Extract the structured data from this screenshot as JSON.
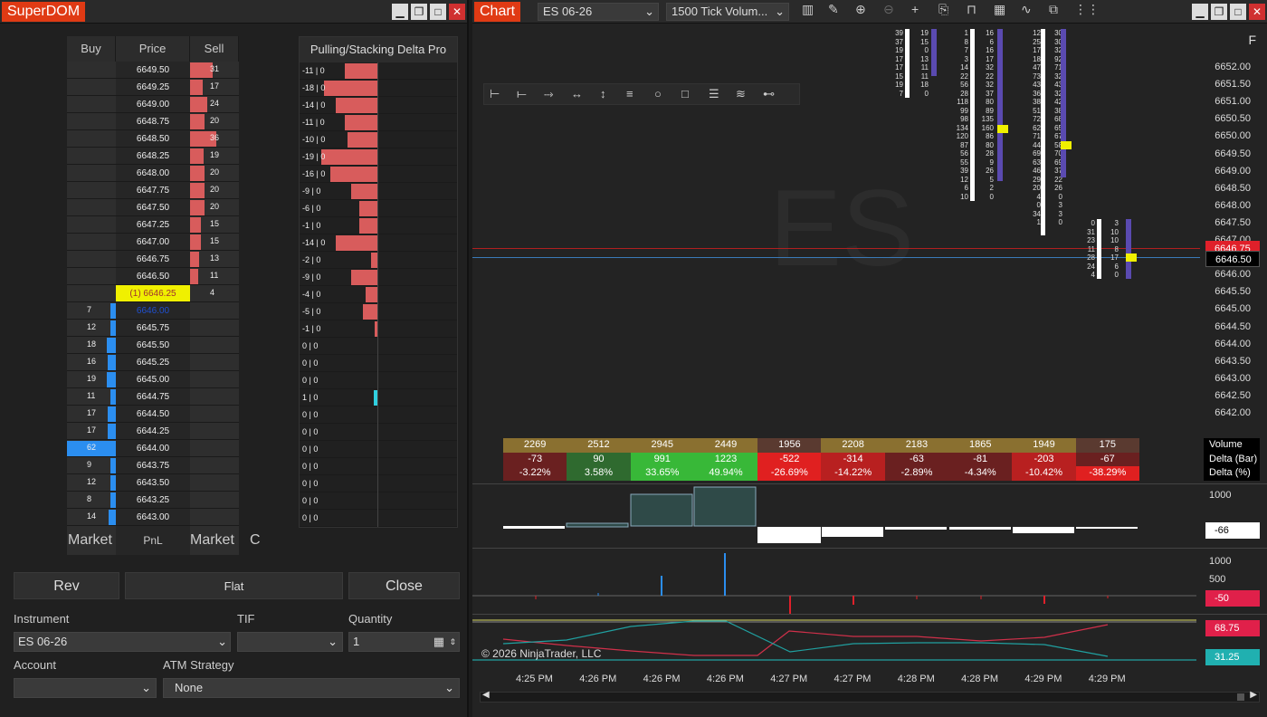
{
  "dom": {
    "title": "SuperDOM",
    "col_buy": "Buy",
    "col_price": "Price",
    "col_sell": "Sell",
    "pull_title": "Pulling/Stacking Delta Pro",
    "rows": [
      {
        "p": "6649.50",
        "s": "31",
        "sw": 0.31,
        "pull": "-11 | 0",
        "pw": 0.58
      },
      {
        "p": "6649.25",
        "s": "17",
        "sw": 0.17,
        "pull": "-18 | 0",
        "pw": 0.95
      },
      {
        "p": "6649.00",
        "s": "24",
        "sw": 0.24,
        "pull": "-14 | 0",
        "pw": 0.74
      },
      {
        "p": "6648.75",
        "s": "20",
        "sw": 0.2,
        "pull": "-11 | 0",
        "pw": 0.58
      },
      {
        "p": "6648.50",
        "s": "36",
        "sw": 0.36,
        "pull": "-10 | 0",
        "pw": 0.53
      },
      {
        "p": "6648.25",
        "s": "19",
        "sw": 0.19,
        "pull": "-19 | 0",
        "pw": 1.0
      },
      {
        "p": "6648.00",
        "s": "20",
        "sw": 0.2,
        "pull": "-16 | 0",
        "pw": 0.84
      },
      {
        "p": "6647.75",
        "s": "20",
        "sw": 0.2,
        "pull": "-9 | 0",
        "pw": 0.47
      },
      {
        "p": "6647.50",
        "s": "20",
        "sw": 0.2,
        "pull": "-6 | 0",
        "pw": 0.32
      },
      {
        "p": "6647.25",
        "s": "15",
        "sw": 0.15,
        "pull": "-1 | 0",
        "pw": 0.32
      },
      {
        "p": "6647.00",
        "s": "15",
        "sw": 0.15,
        "pull": "-14 | 0",
        "pw": 0.74
      },
      {
        "p": "6646.75",
        "s": "13",
        "sw": 0.13,
        "pull": "-2 | 0",
        "pw": 0.12
      },
      {
        "p": "6646.50",
        "s": "11",
        "sw": 0.11,
        "pull": "-9 | 0",
        "pw": 0.47
      },
      {
        "p": "(1) 6646.25",
        "s": "4",
        "sw": 0,
        "pull": "-4 | 0",
        "pw": 0.21,
        "last": true
      },
      {
        "p": "6646.00",
        "b": "7",
        "bw": 0.07,
        "pull": "-5 | 0",
        "pw": 0.26,
        "bidp": true
      },
      {
        "p": "6645.75",
        "b": "12",
        "bw": 0.12,
        "pull": "-1 | 0",
        "pw": 0.05
      },
      {
        "p": "6645.50",
        "b": "18",
        "bw": 0.18,
        "pull": "0 | 0",
        "pw": 0
      },
      {
        "p": "6645.25",
        "b": "16",
        "bw": 0.16,
        "pull": "0 | 0",
        "pw": 0
      },
      {
        "p": "6645.00",
        "b": "19",
        "bw": 0.19,
        "pull": "0 | 0",
        "pw": 0
      },
      {
        "p": "6644.75",
        "b": "11",
        "bw": 0.11,
        "pull": "1 | 0",
        "pw": 0
      },
      {
        "p": "6644.50",
        "b": "17",
        "bw": 0.17,
        "pull": "0 | 0",
        "pw": 0
      },
      {
        "p": "6644.25",
        "b": "17",
        "bw": 0.17,
        "pull": "0 | 0",
        "pw": 0
      },
      {
        "p": "6644.00",
        "b": "62",
        "bw": 1.0,
        "pull": "0 | 0",
        "pw": 0
      },
      {
        "p": "6643.75",
        "b": "9",
        "bw": 0.09,
        "pull": "0 | 0",
        "pw": 0
      },
      {
        "p": "6643.50",
        "b": "12",
        "bw": 0.12,
        "pull": "0 | 0",
        "pw": 0
      },
      {
        "p": "6643.25",
        "b": "8",
        "bw": 0.08,
        "pull": "0 | 0",
        "pw": 0
      },
      {
        "p": "6643.00",
        "b": "14",
        "bw": 0.14,
        "pull": "0 | 0",
        "pw": 0
      }
    ],
    "market_left": "Market",
    "pnl": "PnL",
    "market_right": "Market",
    "c": "C",
    "btn_rev": "Rev",
    "btn_flat": "Flat",
    "btn_close": "Close",
    "lbl_instrument": "Instrument",
    "lbl_tif": "TIF",
    "lbl_quantity": "Quantity",
    "instrument": "ES 06-26",
    "tif": "",
    "quantity": "1",
    "lbl_account": "Account",
    "lbl_atm": "ATM Strategy",
    "account": "",
    "atm": "None"
  },
  "chart": {
    "title": "Chart",
    "instrument": "ES 06-26",
    "bartype": "1500 Tick Volum...",
    "watermark": "ES",
    "f": "F",
    "yticks": [
      "6652.00",
      "6651.50",
      "6651.00",
      "6650.50",
      "6650.00",
      "6649.50",
      "6649.00",
      "6648.50",
      "6648.00",
      "6647.50",
      "6647.00",
      "6646.50",
      "6646.00",
      "6645.50",
      "6645.00",
      "6644.50",
      "6644.00",
      "6643.50",
      "6643.00",
      "6642.50",
      "6642.00"
    ],
    "price_tag": "6646.50",
    "red_tag": "6646.75",
    "volume": [
      "2269",
      "2512",
      "2945",
      "2449",
      "1956",
      "2208",
      "2183",
      "1865",
      "1949",
      "175"
    ],
    "delta_bar": [
      "-73",
      "90",
      "991",
      "1223",
      "-522",
      "-314",
      "-63",
      "-81",
      "-203",
      "-67"
    ],
    "delta_pct": [
      "-3.22%",
      "3.58%",
      "33.65%",
      "49.94%",
      "-26.69%",
      "-14.22%",
      "-2.89%",
      "-4.34%",
      "-10.42%",
      "-38.29%"
    ],
    "row_labels": [
      "Volume",
      "Delta (Bar)",
      "Delta (%)"
    ],
    "pane2_tick": "1000",
    "pane2_tag": "-66",
    "pane3_ticks": [
      "1000",
      "500"
    ],
    "pane3_tag": "-50",
    "pane4_tag1": "68.75",
    "pane4_tag2": "31.25",
    "copyright": "© 2026 NinjaTrader, LLC",
    "xticks": [
      "4:25 PM",
      "4:26 PM",
      "4:26 PM",
      "4:26 PM",
      "4:27 PM",
      "4:27 PM",
      "4:28 PM",
      "4:28 PM",
      "4:29 PM",
      "4:29 PM"
    ],
    "fp1": [
      "39",
      "37",
      "19",
      "17",
      "17",
      "15",
      "19",
      "7"
    ],
    "fp1b": [
      "19",
      "15",
      "0",
      "13",
      "11",
      "11",
      "18",
      "0"
    ],
    "fp2": [
      "1",
      "8",
      "7",
      "3",
      "14",
      "22",
      "56",
      "28",
      "118",
      "99",
      "98",
      "134",
      "120",
      "87",
      "56",
      "55",
      "39",
      "12",
      "6",
      "10"
    ],
    "fp2b": [
      "16",
      "6",
      "16",
      "17",
      "32",
      "22",
      "32",
      "37",
      "80",
      "89",
      "135",
      "160",
      "86",
      "80",
      "28",
      "9",
      "26",
      "5",
      "2",
      "0"
    ],
    "fp3": [
      "12",
      "25",
      "17",
      "18",
      "47",
      "73",
      "43",
      "36",
      "38",
      "51",
      "72",
      "62",
      "71",
      "44",
      "69",
      "63",
      "46",
      "29",
      "20",
      "4",
      "0",
      "34",
      "1"
    ],
    "fp3b": [
      "30",
      "30",
      "32",
      "92",
      "71",
      "32",
      "43",
      "32",
      "42",
      "38",
      "68",
      "65",
      "67",
      "58",
      "70",
      "69",
      "37",
      "22",
      "26",
      "0",
      "3",
      "3",
      "0"
    ],
    "fp4": [
      "0",
      "31",
      "23",
      "11",
      "28",
      "24",
      "4"
    ],
    "fp4b": [
      "3",
      "10",
      "10",
      "8",
      "17",
      "6",
      "0"
    ],
    "colors": {
      "sell": "#d85c5c",
      "buy": "#2b8ef0",
      "accent": "#e03a14",
      "last": "#f0f000"
    }
  }
}
